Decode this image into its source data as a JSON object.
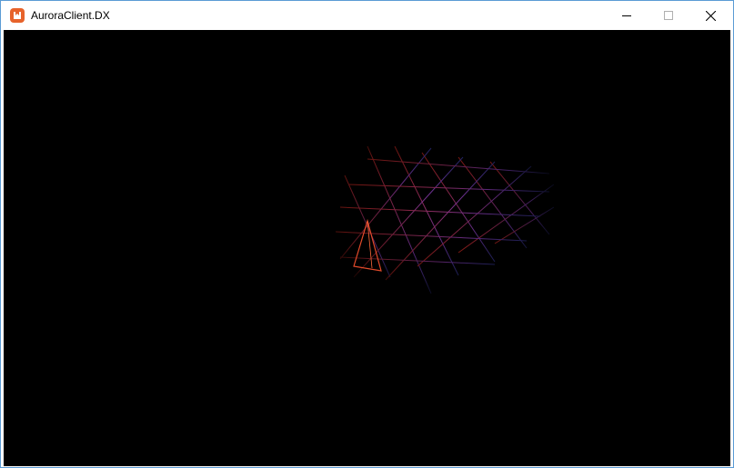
{
  "window": {
    "title": "AuroraClient.DX",
    "icon": "monogame-icon",
    "controls": [
      "minimize-icon",
      "maximize-icon",
      "close-icon"
    ]
  },
  "colors": {
    "frame_border": "#5b9bd5",
    "titlebar_bg": "#ffffff",
    "viewport_bg": "#000000",
    "icon_orange": "#e7632b",
    "mesh_red": "#d12a1f",
    "mesh_purple": "#8d3fb8",
    "mesh_blue": "#3b3ea8"
  }
}
